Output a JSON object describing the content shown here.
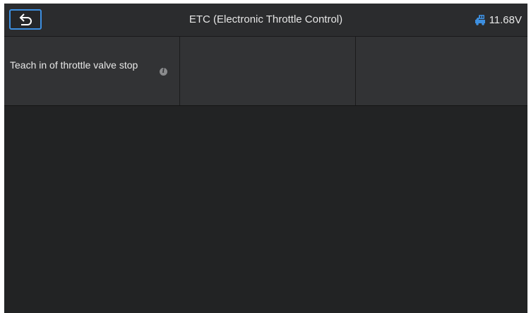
{
  "header": {
    "title": "ETC (Electronic Throttle Control)",
    "back_icon": "back-arrow-icon",
    "battery_icon": "vehicle-battery-icon",
    "battery_voltage": "11.68V"
  },
  "functions": [
    {
      "label": "Teach in of throttle valve stop",
      "info_icon": "info-icon"
    }
  ],
  "colors": {
    "accent": "#3d8fe0",
    "background": "#222324",
    "header": "#2b2c2e",
    "cell": "#323335"
  }
}
